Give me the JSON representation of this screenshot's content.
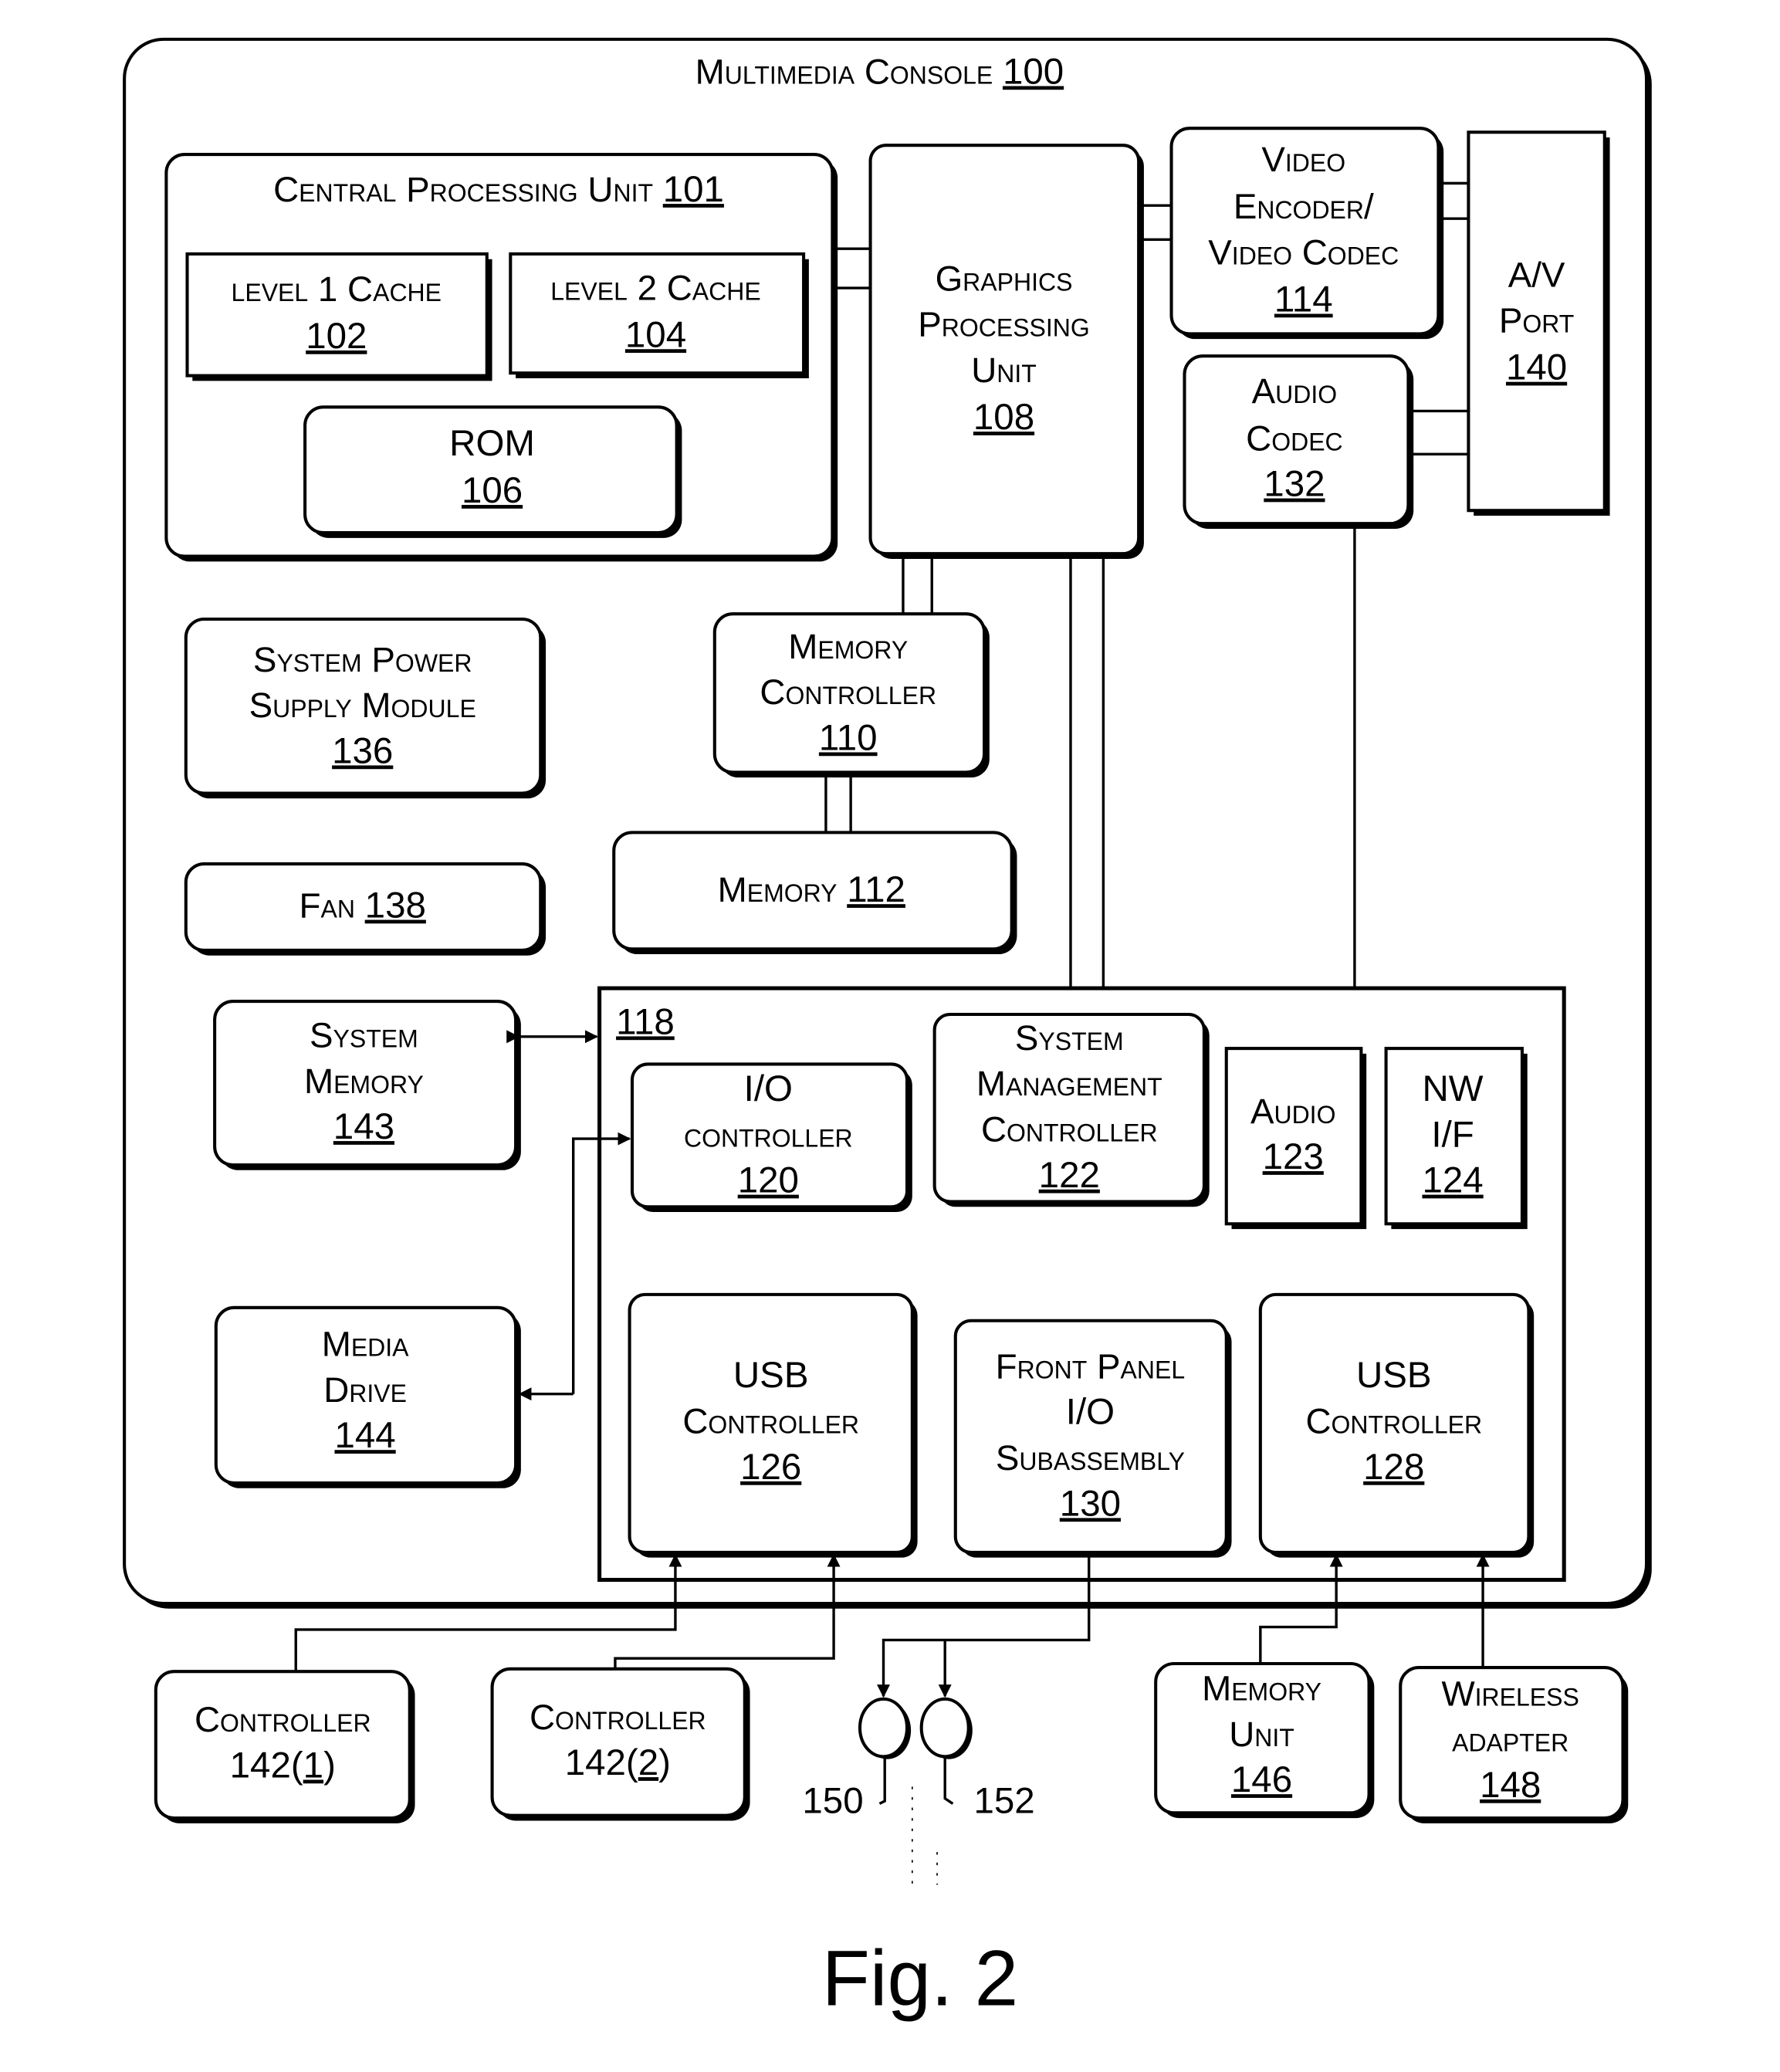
{
  "figure": {
    "caption": "Fig. 2"
  },
  "console": {
    "title": "Multimedia Console",
    "ref": "100"
  },
  "cpu": {
    "title": "Central Processing Unit",
    "ref": "101"
  },
  "l1_cache": {
    "label": "level 1 Cache",
    "ref": "102"
  },
  "l2_cache": {
    "label": "level 2 Cache",
    "ref": "104"
  },
  "rom": {
    "label": "ROM",
    "ref": "106"
  },
  "gpu": {
    "lines": [
      "Graphics",
      "Processing",
      "Unit"
    ],
    "ref": "108"
  },
  "video_encoder": {
    "lines": [
      "Video",
      "Encoder/",
      "Video Codec"
    ],
    "ref": "114"
  },
  "av_port": {
    "lines": [
      "A/V",
      "Port"
    ],
    "ref": "140"
  },
  "audio_codec": {
    "lines": [
      "Audio",
      "Codec"
    ],
    "ref": "132"
  },
  "memory_controller": {
    "lines": [
      "Memory",
      "Controller"
    ],
    "ref": "110"
  },
  "memory": {
    "label": "Memory",
    "ref": "112"
  },
  "power_supply": {
    "lines": [
      "System Power",
      "Supply Module"
    ],
    "ref": "136"
  },
  "fan": {
    "label": "Fan",
    "ref": "138"
  },
  "system_memory": {
    "lines": [
      "System",
      "Memory"
    ],
    "ref": "143"
  },
  "media_drive": {
    "lines": [
      "Media",
      "Drive"
    ],
    "ref": "144"
  },
  "module": {
    "ref": "118"
  },
  "io_controller": {
    "lines": [
      "I/O",
      "controller"
    ],
    "ref": "120"
  },
  "smc": {
    "lines": [
      "System",
      "Management",
      "Controller"
    ],
    "ref": "122"
  },
  "audio_unit": {
    "lines": [
      "Audio"
    ],
    "ref": "123"
  },
  "nw_if": {
    "lines": [
      "NW",
      "I/F"
    ],
    "ref": "124"
  },
  "usb_126": {
    "lines": [
      "USB",
      "Controller"
    ],
    "ref": "126"
  },
  "front_panel": {
    "lines": [
      "Front Panel",
      "I/O",
      "Subassembly"
    ],
    "ref": "130"
  },
  "usb_128": {
    "lines": [
      "USB",
      "Controller"
    ],
    "ref": "128"
  },
  "controller_1": {
    "label": "Controller",
    "prefix": "142(",
    "index": "1",
    "suffix": ")"
  },
  "controller_2": {
    "label": "Controller",
    "prefix": "142(",
    "index": "2",
    "suffix": ")"
  },
  "button_150": {
    "ref": "150"
  },
  "led_152": {
    "ref": "152"
  },
  "memory_unit": {
    "lines": [
      "Memory",
      "Unit"
    ],
    "ref": "146"
  },
  "wireless_adapter": {
    "lines": [
      "Wireless",
      "adapter"
    ],
    "ref": "148"
  }
}
